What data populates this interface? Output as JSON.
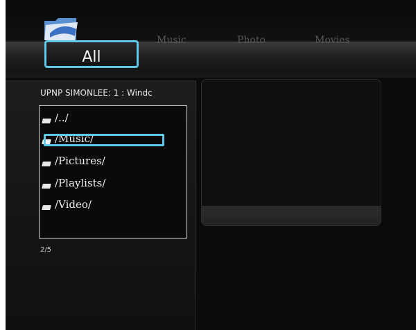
{
  "tabs": {
    "all_label": "All",
    "music_label": "Music",
    "photo_label": "Photo",
    "movies_label": "Movies"
  },
  "browser": {
    "server_title": "UPNP SIMONLEE: 1 : Windc",
    "items": [
      {
        "label": "/../",
        "icon": "folder-icon"
      },
      {
        "label": "/Music/",
        "icon": "folder-icon",
        "selected": true
      },
      {
        "label": "/Pictures/",
        "icon": "folder-icon"
      },
      {
        "label": "/Playlists/",
        "icon": "folder-icon"
      },
      {
        "label": "/Video/",
        "icon": "folder-icon"
      }
    ],
    "page_count": "2/5"
  },
  "colors": {
    "accent": "#5ec8e6",
    "background": "#0b0b0b",
    "text": "#efefef"
  }
}
